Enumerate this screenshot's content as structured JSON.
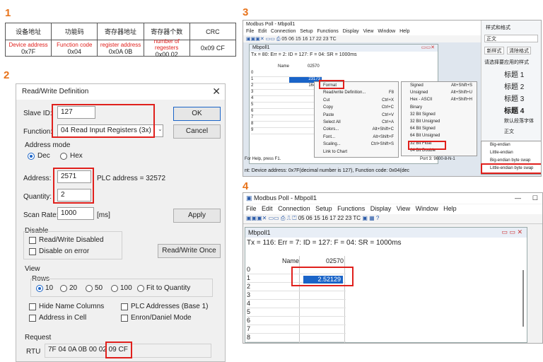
{
  "steps": {
    "s1": "1",
    "s2": "2",
    "s3": "3",
    "s4": "4"
  },
  "panel1": {
    "headers": [
      "设备地址",
      "功能码",
      "寄存器地址",
      "寄存器个数",
      "CRC"
    ],
    "sublabels": [
      "Device address",
      "Function code",
      "register address",
      "number of regesters",
      ""
    ],
    "values": [
      "0x7F",
      "0x04",
      "0x0A 0B",
      "0x00 02",
      "0x09 CF"
    ]
  },
  "panel2": {
    "title": "Read/Write Definition",
    "close_icon": "close-icon",
    "slave_id_label": "Slave ID:",
    "slave_id_value": "127",
    "function_label": "Function:",
    "function_value": "04 Read Input Registers (3x)",
    "ok_label": "OK",
    "cancel_label": "Cancel",
    "address_mode_label": "Address mode",
    "dec_label": "Dec",
    "hex_label": "Hex",
    "address_label": "Address:",
    "address_value": "2571",
    "plc_address": "PLC address = 32572",
    "quantity_label": "Quantity:",
    "quantity_value": "2",
    "scan_rate_label": "Scan Rate:",
    "scan_rate_value": "1000",
    "scan_rate_unit": "[ms]",
    "apply_label": "Apply",
    "disable_label": "Disable",
    "rw_disabled_label": "Read/Write Disabled",
    "disable_on_error_label": "Disable on error",
    "rw_once_label": "Read/Write Once",
    "view_label": "View",
    "rows_label": "Rows",
    "rows_options": [
      "10",
      "20",
      "50",
      "100",
      "Fit to Quantity"
    ],
    "hide_name_columns": "Hide Name Columns",
    "plc_addresses_base1": "PLC Addresses (Base 1)",
    "address_in_cell": "Address in Cell",
    "enron_daniel": "Enron/Daniel Mode",
    "request_label": "Request",
    "rtu_label": "RTU",
    "rtu_bytes": "7F 04 0A 0B 00 02",
    "rtu_crc": "09 CF"
  },
  "panel3": {
    "window_title": "Modbus Poll - Mbpoll1",
    "menu": [
      "File",
      "Edit",
      "Connection",
      "Setup",
      "Functions",
      "Display",
      "View",
      "Window",
      "Help"
    ],
    "toolbar_codes": "05 06 15 16 17 22 23 TC",
    "child_title": "Mbpoll1",
    "status_line": "Tx = 80: Err = 2: ID = 127: F = 04: SR = 1000ms",
    "col_name": "Name",
    "col_addr": "02570",
    "row_ids": [
      "0",
      "1",
      "2",
      "3",
      "4",
      "5",
      "6",
      "7",
      "8",
      "9"
    ],
    "cell_r1": "23173",
    "cell_r2": "16417",
    "context_menu": [
      {
        "label": "Format",
        "shortcut": ""
      },
      {
        "label": "Read/write Definition...",
        "shortcut": "F8"
      },
      {
        "label": "Cut",
        "shortcut": "Ctrl+X"
      },
      {
        "label": "Copy",
        "shortcut": "Ctrl+C"
      },
      {
        "label": "Paste",
        "shortcut": "Ctrl+V"
      },
      {
        "label": "Select All",
        "shortcut": "Ctrl+A"
      },
      {
        "label": "Colors...",
        "shortcut": "Alt+Shift+C"
      },
      {
        "label": "Font...",
        "shortcut": "Alt+Shift+F"
      },
      {
        "label": "Scaling...",
        "shortcut": "Ctrl+Shift+S"
      },
      {
        "label": "Link to Chart",
        "shortcut": ""
      }
    ],
    "format_menu": [
      {
        "label": "Signed",
        "shortcut": "Alt+Shift+S"
      },
      {
        "label": "Unsigned",
        "shortcut": "Alt+Shift+U"
      },
      {
        "label": "Hex - ASCII",
        "shortcut": "Alt+Shift+H"
      },
      {
        "label": "Binary",
        "shortcut": ""
      },
      {
        "label": "32 Bit Signed",
        "shortcut": ""
      },
      {
        "label": "32 Bit Unsigned",
        "shortcut": ""
      },
      {
        "label": "64 Bit Signed",
        "shortcut": ""
      },
      {
        "label": "64 Bit Unsigned",
        "shortcut": ""
      },
      {
        "label": "32 Bit Float",
        "shortcut": ""
      },
      {
        "label": "64 Bit Double",
        "shortcut": ""
      }
    ],
    "byte_order_menu": [
      "Big-endian",
      "Little-endian",
      "Big-endian byte swap",
      "Little-endian byte swap"
    ],
    "help_text": "For Help, press F1.",
    "port_text": "Port 3: 9600-8-N-1",
    "bottom_note": "nt: Device address: 0x7F(decimal number is 127), Function code: 0x04(dec",
    "side_title": "样式和格式",
    "side_items": [
      "正文",
      "新样式",
      "清除格式",
      "请选择要应用的样式",
      "标题 1",
      "标题 2",
      "标题 3",
      "标题 4",
      "默认段落字体",
      "正文"
    ]
  },
  "panel4": {
    "window_title": "Modbus Poll - Mbpoll1",
    "menu": [
      "File",
      "Edit",
      "Connection",
      "Setup",
      "Functions",
      "Display",
      "View",
      "Window",
      "Help"
    ],
    "toolbar_codes": "05 06 15 16 17 22 23 TC",
    "child_title": "Mbpoll1",
    "status_line": "Tx = 116: Err = 7: ID = 127: F = 04: SR = 1000ms",
    "col_name": "Name",
    "col_addr": "02570",
    "row_ids": [
      "0",
      "1",
      "2",
      "3",
      "4",
      "5",
      "6",
      "7",
      "8"
    ],
    "cell_r1": "2.52129"
  },
  "colors": {
    "accent_red": "#e0201c",
    "step_orange": "#e8731a",
    "select_blue": "#1a64c8"
  }
}
